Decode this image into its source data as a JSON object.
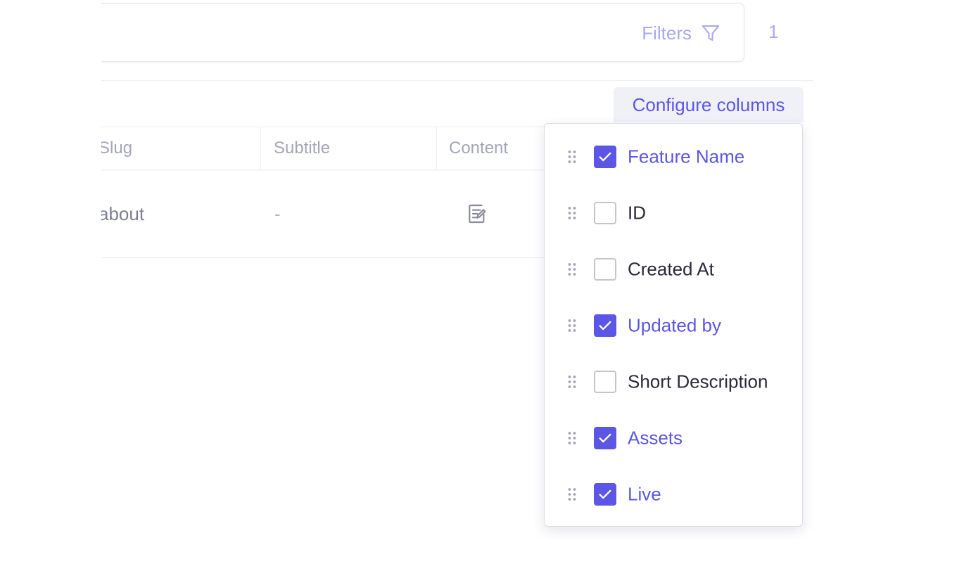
{
  "toolbar": {
    "filters_label": "Filters",
    "page_count": "1",
    "filter_icon": "filter-icon"
  },
  "configure_columns": {
    "label": "Configure columns"
  },
  "table": {
    "headers": [
      "Slug",
      "Subtitle",
      "Content"
    ],
    "rows": [
      {
        "slug": "about",
        "subtitle": "-",
        "content_icon": "edit-icon"
      }
    ]
  },
  "columns_menu": {
    "items": [
      {
        "label": "Feature Name",
        "checked": true
      },
      {
        "label": "ID",
        "checked": false
      },
      {
        "label": "Created At",
        "checked": false
      },
      {
        "label": "Updated by",
        "checked": true
      },
      {
        "label": "Short Description",
        "checked": false
      },
      {
        "label": "Assets",
        "checked": true
      },
      {
        "label": "Live",
        "checked": true
      }
    ]
  },
  "colors": {
    "accent": "#5b56e6",
    "accent_light": "#a9a8f2",
    "muted_text": "#a5a5ba"
  }
}
